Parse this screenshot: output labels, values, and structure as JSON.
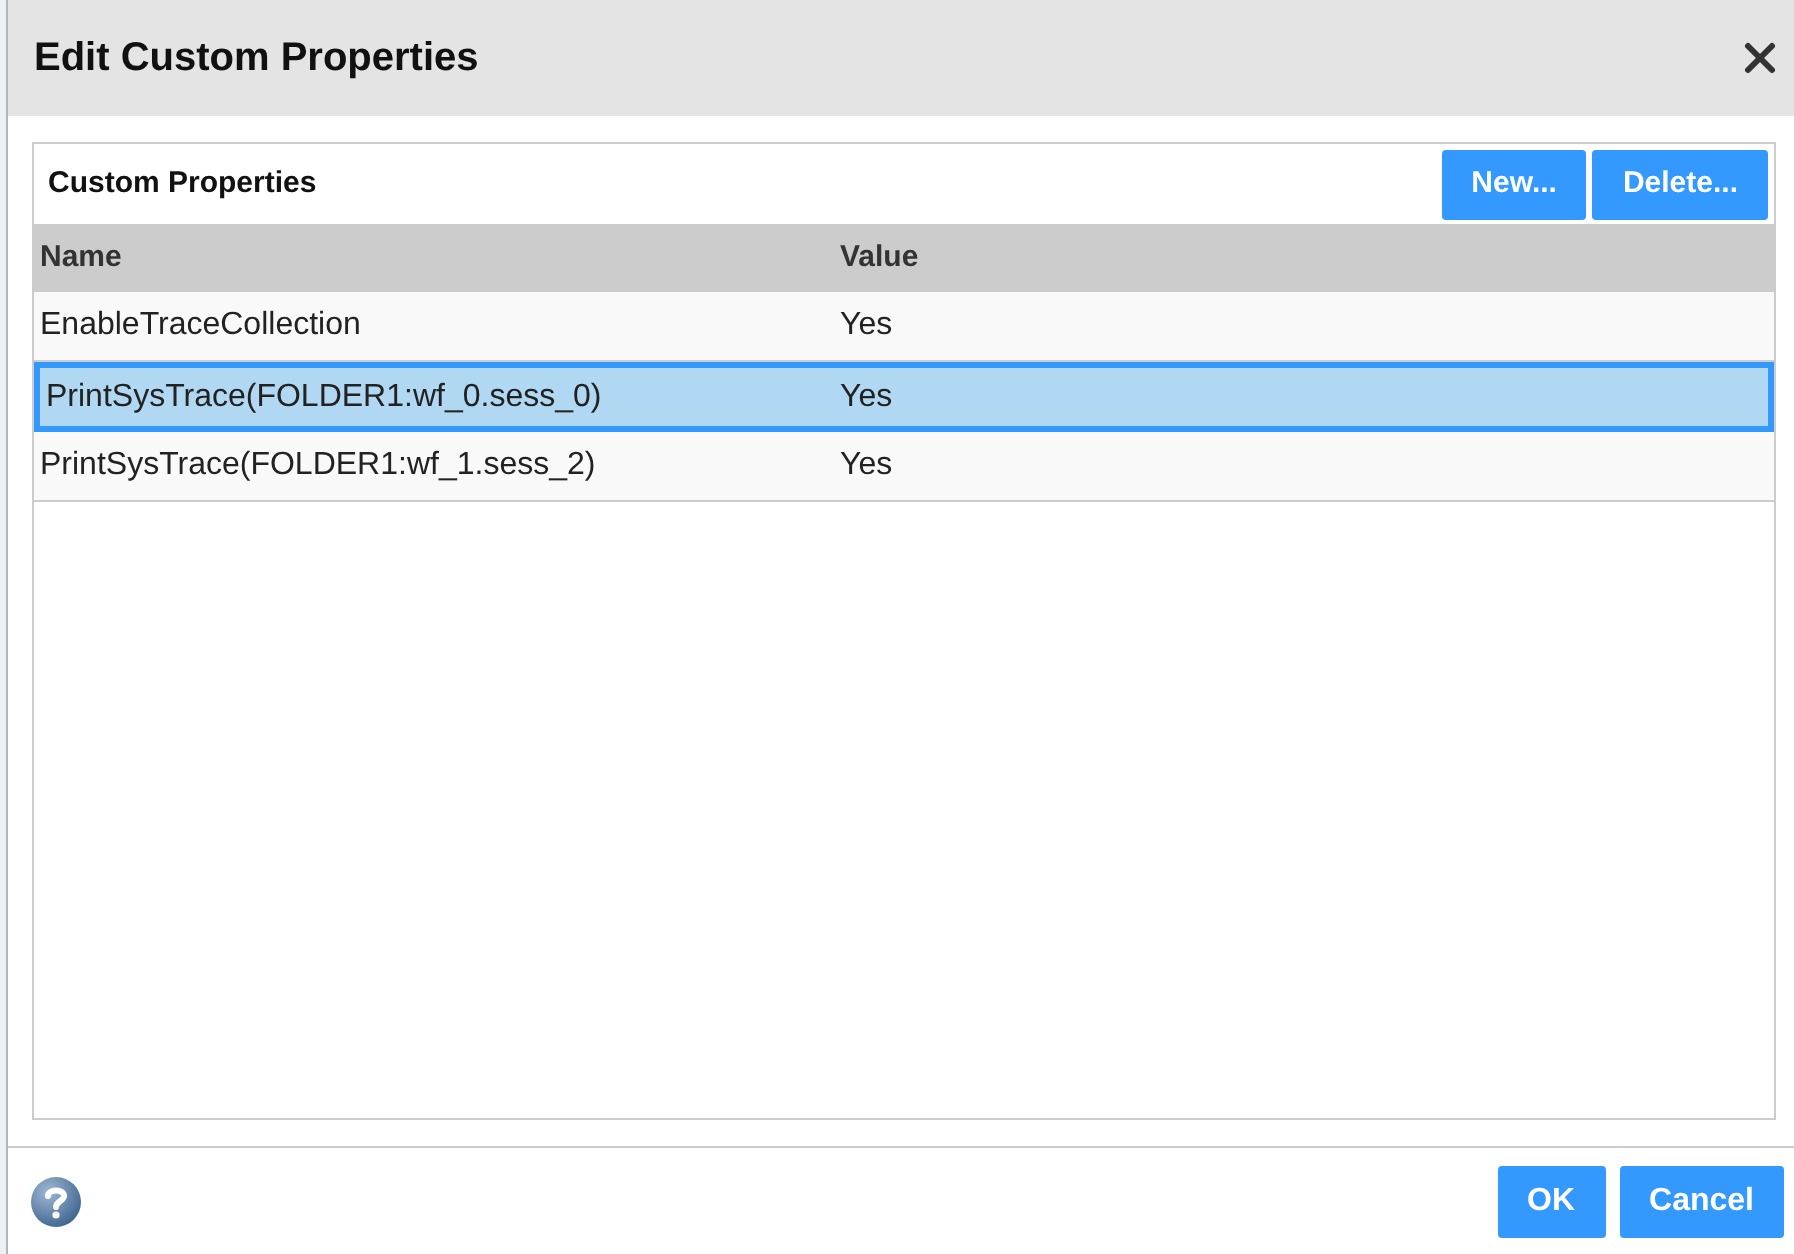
{
  "dialog": {
    "title": "Edit Custom Properties"
  },
  "panel": {
    "title": "Custom Properties",
    "buttons": [
      "New...",
      "Delete..."
    ]
  },
  "table": {
    "columns": [
      "Name",
      "Value"
    ],
    "rows": [
      {
        "name": "EnableTraceCollection",
        "value": "Yes",
        "selected": false
      },
      {
        "name": "PrintSysTrace(FOLDER1:wf_0.sess_0)",
        "value": "Yes",
        "selected": true
      },
      {
        "name": "PrintSysTrace(FOLDER1:wf_1.sess_2)",
        "value": "Yes",
        "selected": false
      }
    ]
  },
  "footer": {
    "buttons": [
      "OK",
      "Cancel"
    ]
  }
}
